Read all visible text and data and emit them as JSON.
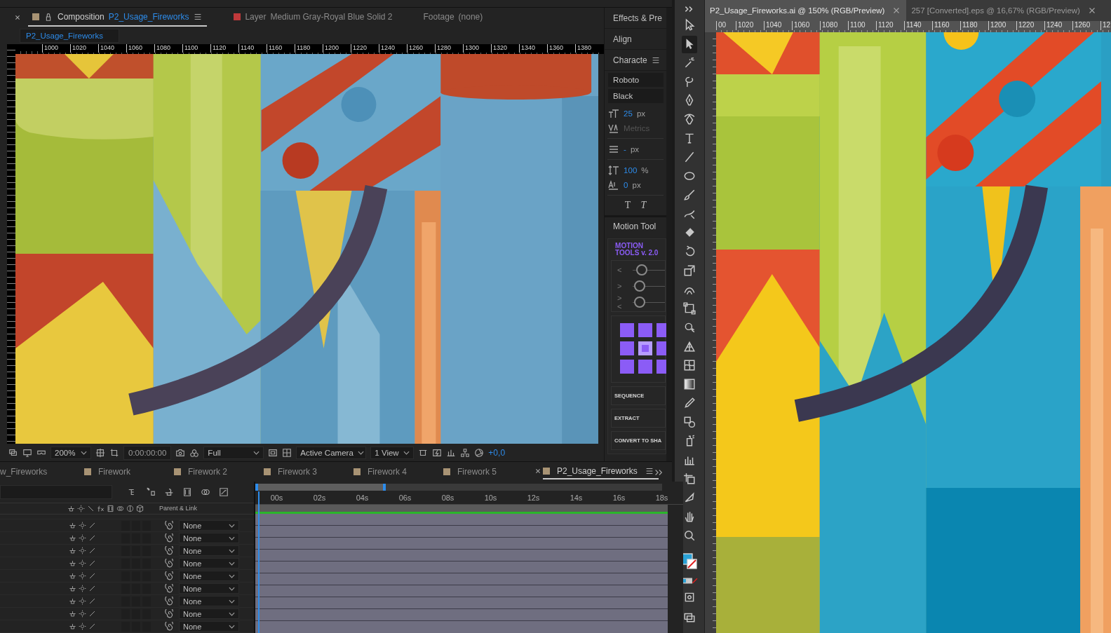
{
  "composition_panel": {
    "tabs": [
      {
        "kind": "composition",
        "label": "Composition",
        "name": "P2_Usage_Fireworks",
        "selected": true
      },
      {
        "kind": "layer",
        "label": "Layer",
        "name": "Medium Gray-Royal Blue Solid 2",
        "selected": false
      },
      {
        "kind": "footage",
        "label": "Footage",
        "name": "(none)",
        "selected": false
      }
    ],
    "breadcrumb": "P2_Usage_Fireworks",
    "ruler_labels": [
      "1000",
      "1020",
      "1040",
      "1060",
      "1080",
      "1100",
      "1120",
      "1140",
      "1160",
      "1180",
      "1200",
      "1220",
      "1240",
      "1260",
      "1280",
      "1300",
      "1320",
      "1340",
      "1360",
      "1380"
    ]
  },
  "viewer_toolbar": {
    "magnification": "200%",
    "timecode": "0:00:00:00",
    "resolution": "Full",
    "view": "Active Camera",
    "layout": "1 View",
    "exposure": "+0,0"
  },
  "side_panel": {
    "panels": [
      "Effects & Pre",
      "Align",
      "Characte"
    ],
    "character": {
      "font": "Roboto",
      "style": "Black",
      "size": "25",
      "size_unit": "px",
      "kerning": "Metrics",
      "leading": "-",
      "leading_unit": "px",
      "vertical_scale": "100",
      "vertical_scale_unit": "%",
      "baseline_shift": "0",
      "baseline_shift_unit": "px",
      "style_buttons": [
        "T",
        "T"
      ]
    },
    "motion_tools": {
      "tab": "Motion Tool",
      "title": "MOTION",
      "subtitle": "TOOLS v. 2.0",
      "sliders": [
        {
          "label": "<",
          "level": 0.15
        },
        {
          "label": ">",
          "level": 0.08
        },
        {
          "label": "><",
          "level": 0.08
        }
      ],
      "anchors": [
        {
          "selected": false
        },
        {
          "selected": false
        },
        {
          "selected": false
        },
        {
          "selected": false
        },
        {
          "selected": true
        },
        {
          "selected": false
        },
        {
          "selected": false
        },
        {
          "selected": false
        },
        {
          "selected": false
        }
      ],
      "buttons": [
        "SEQUENCE",
        "EXTRACT",
        "CONVERT TO SHA"
      ]
    }
  },
  "timeline": {
    "tabs": [
      {
        "label": "w_Fireworks",
        "selected": false
      },
      {
        "label": "Firework",
        "selected": false
      },
      {
        "label": "Firework 2",
        "selected": false
      },
      {
        "label": "Firework 3",
        "selected": false
      },
      {
        "label": "Firework 4",
        "selected": false
      },
      {
        "label": "Firework 5",
        "selected": false
      },
      {
        "label": "P2_Usage_Fireworks",
        "selected": true
      }
    ],
    "time_labels": [
      "00s",
      "02s",
      "04s",
      "06s",
      "08s",
      "10s",
      "12s",
      "14s",
      "16s",
      "18s"
    ],
    "column_header": "Parent & Link",
    "layers": [
      {
        "parent": "None"
      },
      {
        "parent": "None"
      },
      {
        "parent": "None"
      },
      {
        "parent": "None"
      },
      {
        "parent": "None"
      },
      {
        "parent": "None"
      },
      {
        "parent": "None"
      },
      {
        "parent": "None"
      },
      {
        "parent": "None"
      }
    ]
  },
  "illustrator": {
    "tools": [
      {
        "kind": "selection",
        "selected": false
      },
      {
        "kind": "direct-selection",
        "selected": true
      },
      {
        "kind": "magic-wand",
        "selected": false
      },
      {
        "kind": "lasso",
        "selected": false
      },
      {
        "kind": "pen",
        "selected": false
      },
      {
        "kind": "curvature",
        "selected": false
      },
      {
        "kind": "type",
        "selected": false
      },
      {
        "kind": "line",
        "selected": false
      },
      {
        "kind": "ellipse",
        "selected": false
      },
      {
        "kind": "paintbrush",
        "selected": false
      },
      {
        "kind": "pencil",
        "selected": false
      },
      {
        "kind": "eraser",
        "selected": false
      },
      {
        "kind": "rotate",
        "selected": false
      },
      {
        "kind": "scale",
        "selected": false
      },
      {
        "kind": "warp",
        "selected": false
      },
      {
        "kind": "free-transform",
        "selected": false
      },
      {
        "kind": "shape-builder",
        "selected": false
      },
      {
        "kind": "perspective",
        "selected": false
      },
      {
        "kind": "mesh",
        "selected": false
      },
      {
        "kind": "gradient",
        "selected": false
      },
      {
        "kind": "eyedropper",
        "selected": false
      },
      {
        "kind": "blend",
        "selected": false
      },
      {
        "kind": "symbol",
        "selected": false
      },
      {
        "kind": "graph",
        "selected": false
      },
      {
        "kind": "artboard",
        "selected": false
      },
      {
        "kind": "slice",
        "selected": false
      },
      {
        "kind": "hand",
        "selected": false
      },
      {
        "kind": "zoom",
        "selected": false
      }
    ],
    "documents": [
      {
        "title": "P2_Usage_Fireworks.ai @ 150% (RGB/Preview)",
        "selected": true
      },
      {
        "title": "257 [Converted].eps @ 16,67% (RGB/Preview)",
        "selected": false
      }
    ],
    "ruler_labels": [
      "00",
      "1020",
      "1040",
      "1060",
      "1080",
      "1100",
      "1120",
      "1140",
      "1160",
      "1180",
      "1200",
      "1220",
      "1240",
      "1260",
      "12"
    ]
  }
}
